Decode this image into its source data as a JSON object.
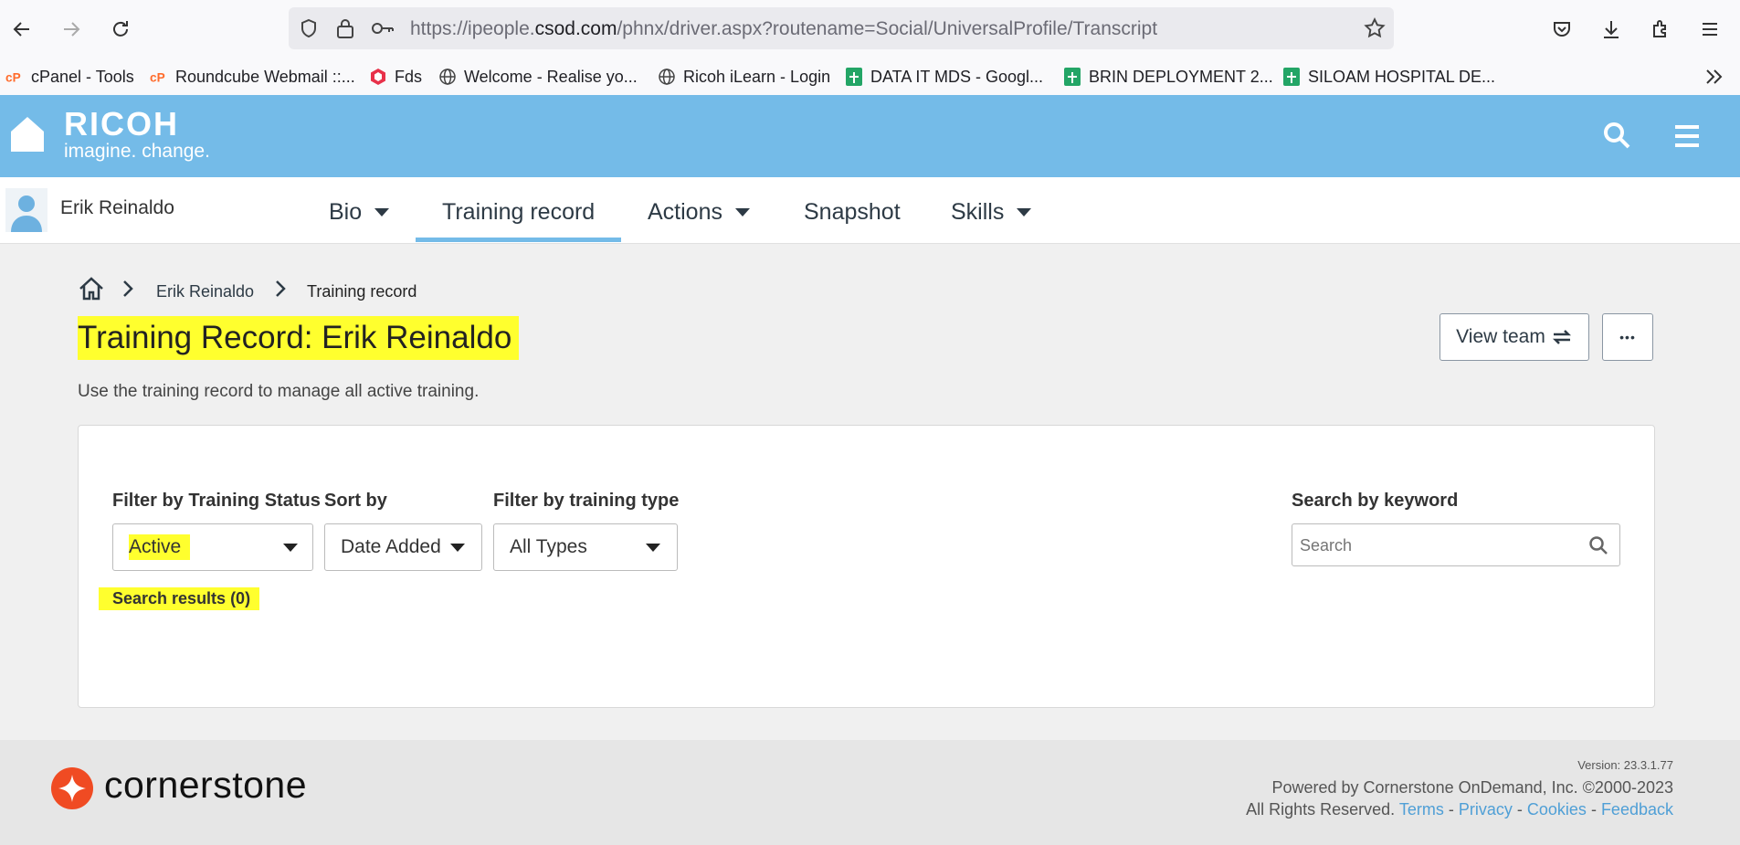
{
  "browser": {
    "url_prefix": "https://ipeople.",
    "url_domain": "csod.com",
    "url_rest": "/phnx/driver.aspx?routename=Social/UniversalProfile/Transcript",
    "bookmarks": [
      {
        "label": "cPanel - Tools",
        "icon": "cpanel-icon"
      },
      {
        "label": "Roundcube Webmail ::...",
        "icon": "cpanel-icon"
      },
      {
        "label": "Fds",
        "icon": "fds-icon"
      },
      {
        "label": "Welcome - Realise yo...",
        "icon": "globe-icon"
      },
      {
        "label": "Ricoh iLearn - Login",
        "icon": "globe-icon"
      },
      {
        "label": "DATA IT MDS - Googl...",
        "icon": "sheets-icon"
      },
      {
        "label": "BRIN DEPLOYMENT 2...",
        "icon": "sheets-icon"
      },
      {
        "label": "SILOAM HOSPITAL DE...",
        "icon": "sheets-icon"
      }
    ]
  },
  "header": {
    "brand": "RICOH",
    "tagline": "imagine. change.",
    "accent_color": "#74bbe8"
  },
  "profile_nav": {
    "user_name": "Erik Reinaldo",
    "tabs": [
      {
        "label": "Bio",
        "dropdown": true
      },
      {
        "label": "Training record",
        "dropdown": false,
        "active": true
      },
      {
        "label": "Actions",
        "dropdown": true
      },
      {
        "label": "Snapshot",
        "dropdown": false
      },
      {
        "label": "Skills",
        "dropdown": true
      }
    ]
  },
  "breadcrumb": {
    "items": [
      "Erik Reinaldo",
      "Training record"
    ]
  },
  "page": {
    "title": "Training Record: Erik Reinaldo",
    "description": "Use the training record to manage all active training.",
    "view_team_label": "View team",
    "more_label": "•••"
  },
  "filters": {
    "status_label": "Filter by Training Status",
    "status_value": "Active",
    "sort_label": "Sort by",
    "sort_value": "Date Added",
    "type_label": "Filter by training type",
    "type_value": "All Types",
    "keyword_label": "Search by keyword",
    "keyword_placeholder": "Search"
  },
  "results": {
    "label": "Search results (0)"
  },
  "footer": {
    "brand": "cornerstone",
    "version": "Version: 23.3.1.77",
    "powered": "Powered by Cornerstone OnDemand, Inc. ©2000-2023",
    "rights": "All Rights Reserved.",
    "links": [
      "Terms",
      "Privacy",
      "Cookies",
      "Feedback"
    ],
    "link_color": "#4f9fd6"
  }
}
